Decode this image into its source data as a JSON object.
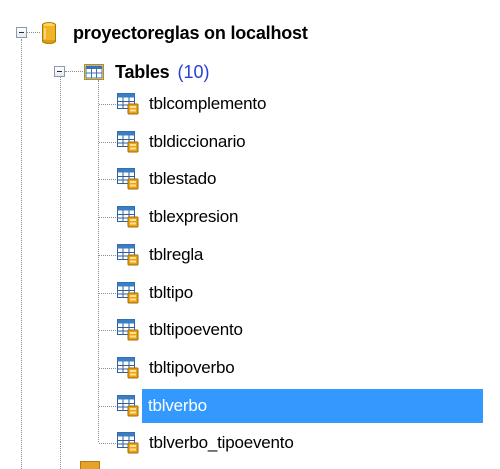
{
  "tree": {
    "database": {
      "name": "proyectoreglas on localhost",
      "expanded": true,
      "icon": "database-icon"
    },
    "tables_group": {
      "label": "Tables",
      "count": "(10)",
      "expanded": true,
      "icon": "tables-folder-icon"
    },
    "tables": [
      {
        "name": "tblcomplemento",
        "selected": false
      },
      {
        "name": "tbldiccionario",
        "selected": false
      },
      {
        "name": "tblestado",
        "selected": false
      },
      {
        "name": "tblexpresion",
        "selected": false
      },
      {
        "name": "tblregla",
        "selected": false
      },
      {
        "name": "tbltipo",
        "selected": false
      },
      {
        "name": "tbltipoevento",
        "selected": false
      },
      {
        "name": "tbltipoverbo",
        "selected": false
      },
      {
        "name": "tblverbo",
        "selected": true
      },
      {
        "name": "tblverbo_tipoevento",
        "selected": false
      }
    ]
  },
  "colors": {
    "selection": "#3399ff",
    "count_text": "#2a3fd6",
    "db_icon": "#f0b429",
    "table_icon_header": "#3a7fc4",
    "table_icon_lock": "#e8a317",
    "connector": "#8e8e8e"
  }
}
